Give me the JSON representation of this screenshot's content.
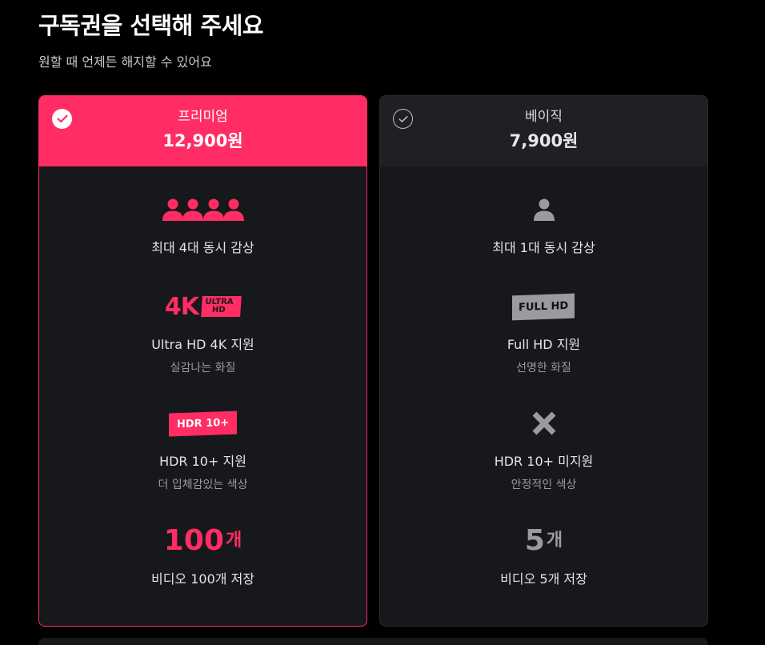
{
  "header": {
    "title": "구독권을 선택해 주세요",
    "subtitle": "원할 때 언제든 해지할 수 있어요"
  },
  "plans": [
    {
      "name": "프리미엄",
      "price": "12,900원",
      "selected": true,
      "accent": "#ff2d64",
      "features": {
        "streams": {
          "icon": "four-people-icon",
          "label": "최대 4대 동시 감상"
        },
        "quality": {
          "badge_main": "4K",
          "badge_box_line1": "ULTRA",
          "badge_box_line2": "HD",
          "label": "Ultra HD 4K 지원",
          "sub": "실감나는 화질"
        },
        "hdr": {
          "badge": "HDR 10+",
          "label": "HDR 10+ 지원",
          "sub": "더 입체감있는 색상"
        },
        "storage": {
          "count": "100",
          "unit": "개",
          "label": "비디오 100개 저장"
        }
      }
    },
    {
      "name": "베이직",
      "price": "7,900원",
      "selected": false,
      "accent": "#9a9aa0",
      "features": {
        "streams": {
          "icon": "single-person-icon",
          "label": "최대 1대 동시 감상"
        },
        "quality": {
          "badge": "FULL HD",
          "label": "Full HD 지원",
          "sub": "선명한 화질"
        },
        "hdr": {
          "icon": "x-mark-icon",
          "label": "HDR 10+ 미지원",
          "sub": "안정적인 색상"
        },
        "storage": {
          "count": "5",
          "unit": "개",
          "label": "비디오 5개 저장"
        }
      }
    }
  ]
}
